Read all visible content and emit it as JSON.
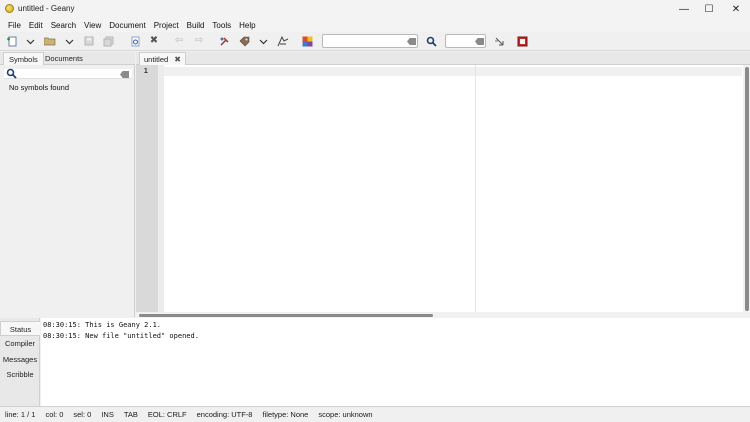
{
  "window": {
    "title": "untitled - Geany",
    "minimize_glyph": "—",
    "maximize_glyph": "☐",
    "close_glyph": "✕"
  },
  "menubar": [
    "File",
    "Edit",
    "Search",
    "View",
    "Document",
    "Project",
    "Build",
    "Tools",
    "Help"
  ],
  "sidebar": {
    "tabs": [
      "Symbols",
      "Documents"
    ],
    "active_tab": "Symbols",
    "search_placeholder": "",
    "empty_text": "No symbols found"
  },
  "editor": {
    "tabs": [
      {
        "label": "untitled",
        "close_glyph": "✖"
      }
    ],
    "line_numbers": [
      "1"
    ],
    "content": ""
  },
  "toolbar": {
    "search_value": "",
    "goto_value": ""
  },
  "messages": {
    "tabs": [
      "Status",
      "Compiler",
      "Messages",
      "Scribble"
    ],
    "active_tab": "Status",
    "log": [
      "08:30:15: This is Geany 2.1.",
      "08:30:15: New file \"untitled\" opened."
    ]
  },
  "statusbar": {
    "line": "line: 1 / 1",
    "col": "col: 0",
    "sel": "sel: 0",
    "mode": "INS",
    "indent": "TAB",
    "eol": "EOL: CRLF",
    "encoding": "encoding: UTF-8",
    "filetype": "filetype: None",
    "scope": "scope: unknown"
  },
  "colors": {
    "accent": "#2a5db0",
    "gutter": "#d9d9d9",
    "scrollbar_thumb": "#8a8a8a"
  }
}
